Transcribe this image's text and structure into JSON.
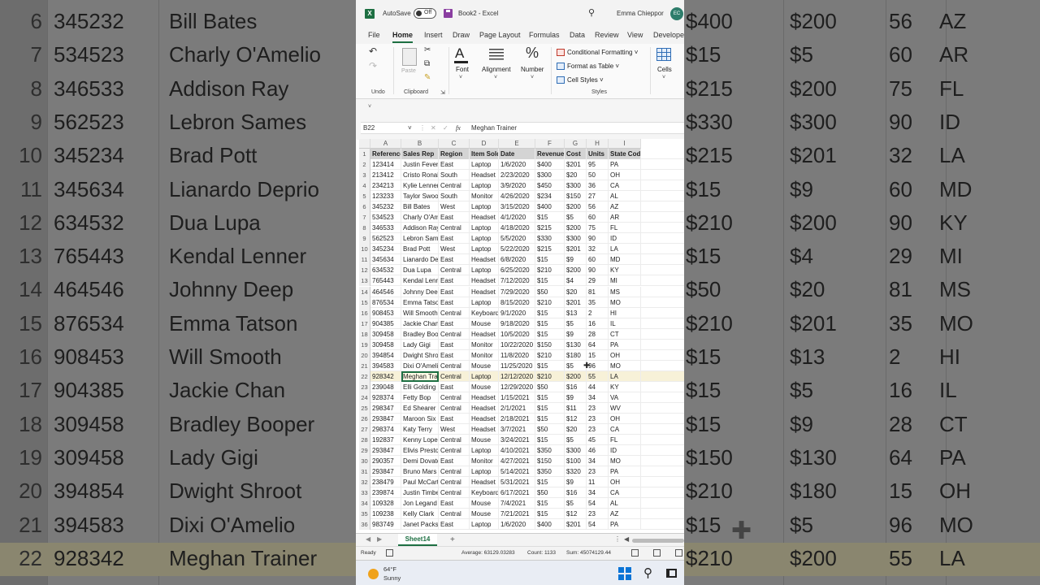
{
  "background_left": {
    "rows": [
      {
        "rownum": "6",
        "ref": "345232",
        "name": "Bill Bates"
      },
      {
        "rownum": "7",
        "ref": "534523",
        "name": "Charly O'Amelio"
      },
      {
        "rownum": "8",
        "ref": "346533",
        "name": "Addison Ray"
      },
      {
        "rownum": "9",
        "ref": "562523",
        "name": "Lebron Sames"
      },
      {
        "rownum": "10",
        "ref": "345234",
        "name": "Brad Pott"
      },
      {
        "rownum": "11",
        "ref": "345634",
        "name": "Lianardo Deprio"
      },
      {
        "rownum": "12",
        "ref": "634532",
        "name": "Dua Lupa"
      },
      {
        "rownum": "13",
        "ref": "765443",
        "name": "Kendal Lenner"
      },
      {
        "rownum": "14",
        "ref": "464546",
        "name": "Johnny Deep"
      },
      {
        "rownum": "15",
        "ref": "876534",
        "name": "Emma Tatson"
      },
      {
        "rownum": "16",
        "ref": "908453",
        "name": "Will Smooth"
      },
      {
        "rownum": "17",
        "ref": "904385",
        "name": "Jackie Chan"
      },
      {
        "rownum": "18",
        "ref": "309458",
        "name": "Bradley Booper"
      },
      {
        "rownum": "19",
        "ref": "309458",
        "name": "Lady Gigi"
      },
      {
        "rownum": "20",
        "ref": "394854",
        "name": "Dwight Shroot"
      },
      {
        "rownum": "21",
        "ref": "394583",
        "name": "Dixi O'Amelio"
      },
      {
        "rownum": "22",
        "ref": "928342",
        "name": "Meghan Trainer"
      }
    ]
  },
  "background_right": {
    "rows": [
      {
        "rev": "$400",
        "cost": "$200",
        "units": "56",
        "state": "AZ"
      },
      {
        "rev": "$15",
        "cost": "$5",
        "units": "60",
        "state": "AR"
      },
      {
        "rev": "$215",
        "cost": "$200",
        "units": "75",
        "state": "FL"
      },
      {
        "rev": "$330",
        "cost": "$300",
        "units": "90",
        "state": "ID"
      },
      {
        "rev": "$215",
        "cost": "$201",
        "units": "32",
        "state": "LA"
      },
      {
        "rev": "$15",
        "cost": "$9",
        "units": "60",
        "state": "MD"
      },
      {
        "rev": "$210",
        "cost": "$200",
        "units": "90",
        "state": "KY"
      },
      {
        "rev": "$15",
        "cost": "$4",
        "units": "29",
        "state": "MI"
      },
      {
        "rev": "$50",
        "cost": "$20",
        "units": "81",
        "state": "MS"
      },
      {
        "rev": "$210",
        "cost": "$201",
        "units": "35",
        "state": "MO"
      },
      {
        "rev": "$15",
        "cost": "$13",
        "units": "2",
        "state": "HI"
      },
      {
        "rev": "$15",
        "cost": "$5",
        "units": "16",
        "state": "IL"
      },
      {
        "rev": "$15",
        "cost": "$9",
        "units": "28",
        "state": "CT"
      },
      {
        "rev": "$150",
        "cost": "$130",
        "units": "64",
        "state": "PA"
      },
      {
        "rev": "$210",
        "cost": "$180",
        "units": "15",
        "state": "OH"
      },
      {
        "rev": "$15",
        "cost": "$5",
        "units": "96",
        "state": "MO"
      },
      {
        "rev": "$210",
        "cost": "$200",
        "units": "55",
        "state": "LA"
      }
    ]
  },
  "titlebar": {
    "logo": "X",
    "autosave_label": "AutoSave",
    "autosave_state": "Off",
    "doc_name": "Book2 - Excel",
    "user_name": "Emma Chieppor",
    "user_initials": "EC"
  },
  "tabs": [
    "File",
    "Home",
    "Insert",
    "Draw",
    "Page Layout",
    "Formulas",
    "Data",
    "Review",
    "View",
    "Develope"
  ],
  "ribbon": {
    "undo_label": "Undo",
    "paste_label": "Paste",
    "clipboard_label": "Clipboard",
    "font_label": "Font",
    "font_glyph": "A",
    "alignment_label": "Alignment",
    "number_label": "Number",
    "number_glyph": "%",
    "conditional_formatting": "Conditional Formatting ˅",
    "format_as_table": "Format as Table ˅",
    "cell_styles": "Cell Styles ˅",
    "styles_label": "Styles",
    "cells_label": "Cells"
  },
  "formula_bar": {
    "name_box": "B22",
    "fx": "fx",
    "value": "Meghan Trainer"
  },
  "grid": {
    "columns": [
      "A",
      "B",
      "C",
      "D",
      "E",
      "F",
      "G",
      "H",
      "I"
    ],
    "headers": [
      "Reference",
      "Sales Rep",
      "Region",
      "Item Sold",
      "Date",
      "Revenue",
      "Cost",
      "Units",
      "State Code"
    ],
    "rows": [
      [
        "123414",
        "Justin Fever",
        "East",
        "Laptop",
        "1/6/2020",
        "$400",
        "$201",
        "95",
        "PA"
      ],
      [
        "213412",
        "Cristo Ronald",
        "South",
        "Headset",
        "2/23/2020",
        "$300",
        "$20",
        "50",
        "OH"
      ],
      [
        "234213",
        "Kylie Lenner",
        "Central",
        "Laptop",
        "3/9/2020",
        "$450",
        "$300",
        "36",
        "CA"
      ],
      [
        "123233",
        "Taylor Swooft",
        "South",
        "Monitor",
        "4/26/2020",
        "$234",
        "$150",
        "27",
        "AL"
      ],
      [
        "345232",
        "Bill Bates",
        "West",
        "Laptop",
        "3/15/2020",
        "$400",
        "$200",
        "56",
        "AZ"
      ],
      [
        "534523",
        "Charly O'Amelio",
        "East",
        "Headset",
        "4/1/2020",
        "$15",
        "$5",
        "60",
        "AR"
      ],
      [
        "346533",
        "Addison Ray",
        "Central",
        "Laptop",
        "4/18/2020",
        "$215",
        "$200",
        "75",
        "FL"
      ],
      [
        "562523",
        "Lebron Sames",
        "East",
        "Laptop",
        "5/5/2020",
        "$330",
        "$300",
        "90",
        "ID"
      ],
      [
        "345234",
        "Brad Pott",
        "West",
        "Laptop",
        "5/22/2020",
        "$215",
        "$201",
        "32",
        "LA"
      ],
      [
        "345634",
        "Lianardo Deprio",
        "East",
        "Headset",
        "6/8/2020",
        "$15",
        "$9",
        "60",
        "MD"
      ],
      [
        "634532",
        "Dua Lupa",
        "Central",
        "Laptop",
        "6/25/2020",
        "$210",
        "$200",
        "90",
        "KY"
      ],
      [
        "765443",
        "Kendal Lenner",
        "East",
        "Headset",
        "7/12/2020",
        "$15",
        "$4",
        "29",
        "MI"
      ],
      [
        "464546",
        "Johnny Deep",
        "East",
        "Headset",
        "7/29/2020",
        "$50",
        "$20",
        "81",
        "MS"
      ],
      [
        "876534",
        "Emma Tatson",
        "East",
        "Laptop",
        "8/15/2020",
        "$210",
        "$201",
        "35",
        "MO"
      ],
      [
        "908453",
        "Will Smooth",
        "Central",
        "Keyboard",
        "9/1/2020",
        "$15",
        "$13",
        "2",
        "HI"
      ],
      [
        "904385",
        "Jackie Chan",
        "East",
        "Mouse",
        "9/18/2020",
        "$15",
        "$5",
        "16",
        "IL"
      ],
      [
        "309458",
        "Bradley Booper",
        "Central",
        "Headset",
        "10/5/2020",
        "$15",
        "$9",
        "28",
        "CT"
      ],
      [
        "309458",
        "Lady Gigi",
        "East",
        "Monitor",
        "10/22/2020",
        "$150",
        "$130",
        "64",
        "PA"
      ],
      [
        "394854",
        "Dwight Shroot",
        "East",
        "Monitor",
        "11/8/2020",
        "$210",
        "$180",
        "15",
        "OH"
      ],
      [
        "394583",
        "Dixi O'Amelio",
        "Central",
        "Mouse",
        "11/25/2020",
        "$15",
        "$5",
        "96",
        "MO"
      ],
      [
        "928342",
        "Meghan Trainer",
        "Central",
        "Laptop",
        "12/12/2020",
        "$210",
        "$200",
        "55",
        "LA"
      ],
      [
        "239048",
        "Elli Golding",
        "East",
        "Mouse",
        "12/29/2020",
        "$50",
        "$16",
        "44",
        "KY"
      ],
      [
        "928374",
        "Fetty Bop",
        "Central",
        "Headset",
        "1/15/2021",
        "$15",
        "$9",
        "34",
        "VA"
      ],
      [
        "298347",
        "Ed Shearer",
        "Central",
        "Headset",
        "2/1/2021",
        "$15",
        "$11",
        "23",
        "WV"
      ],
      [
        "293847",
        "Maroon Six",
        "East",
        "Headset",
        "2/18/2021",
        "$15",
        "$12",
        "23",
        "OH"
      ],
      [
        "298374",
        "Katy Terry",
        "West",
        "Headset",
        "3/7/2021",
        "$50",
        "$20",
        "23",
        "CA"
      ],
      [
        "192837",
        "Kenny Lopez",
        "Central",
        "Mouse",
        "3/24/2021",
        "$15",
        "$5",
        "45",
        "FL"
      ],
      [
        "293847",
        "Elivis Preston",
        "Central",
        "Laptop",
        "4/10/2021",
        "$350",
        "$300",
        "46",
        "ID"
      ],
      [
        "290357",
        "Demi Dovato",
        "East",
        "Monitor",
        "4/27/2021",
        "$150",
        "$100",
        "34",
        "MO"
      ],
      [
        "293847",
        "Bruno Mars",
        "Central",
        "Laptop",
        "5/14/2021",
        "$350",
        "$320",
        "23",
        "PA"
      ],
      [
        "238479",
        "Paul McCart",
        "Central",
        "Headset",
        "5/31/2021",
        "$15",
        "$9",
        "11",
        "OH"
      ],
      [
        "239874",
        "Justin Timber",
        "Central",
        "Keyboard",
        "6/17/2021",
        "$50",
        "$16",
        "34",
        "CA"
      ],
      [
        "109328",
        "Jon Legand",
        "East",
        "Mouse",
        "7/4/2021",
        "$15",
        "$5",
        "54",
        "AL"
      ],
      [
        "109238",
        "Kelly Clark",
        "Central",
        "Mouse",
        "7/21/2021",
        "$15",
        "$12",
        "23",
        "AZ"
      ],
      [
        "983749",
        "Janet Packson",
        "East",
        "Laptop",
        "1/6/2020",
        "$400",
        "$201",
        "54",
        "PA"
      ]
    ]
  },
  "sheetbar": {
    "sheet_name": "Sheet14",
    "add": "+"
  },
  "statusbar": {
    "ready": "Ready",
    "average": "Average: 63129.03283",
    "count": "Count: 1133",
    "sum": "Sum: 45074129.44"
  },
  "taskbar": {
    "temp": "64°F",
    "condition": "Sunny"
  }
}
